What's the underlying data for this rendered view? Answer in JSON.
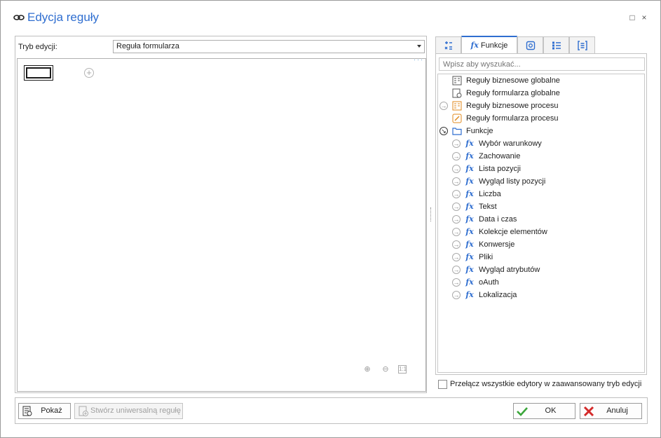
{
  "window": {
    "title": "Edycja reguły",
    "maximize_glyph": "□",
    "close_glyph": "×"
  },
  "editor": {
    "mode_label": "Tryb edycji:",
    "mode_value": "Reguła formularza",
    "add_glyph": "+",
    "zoom_in_glyph": "⊕",
    "zoom_out_glyph": "⊖",
    "zoom_reset_glyph": "1:1"
  },
  "tabs": {
    "operators_icon": "operators-icon",
    "functions_label": "Funkcje",
    "values_icon": "values-icon",
    "list_icon": "list-icon",
    "form_icon": "form-icon"
  },
  "search": {
    "placeholder": "Wpisz aby wyszukać..."
  },
  "tree": {
    "global_business": "Reguły biznesowe globalne",
    "global_form": "Reguły formularza globalne",
    "process_business": "Reguły biznesowe procesu",
    "process_form": "Reguły formularza procesu",
    "functions": "Funkcje",
    "function_items": [
      "Wybór warunkowy",
      "Zachowanie",
      "Lista pozycji",
      "Wygląd listy pozycji",
      "Liczba",
      "Tekst",
      "Data i czas",
      "Kolekcje elementów",
      "Konwersje",
      "Pliki",
      "Wygląd atrybutów",
      "oAuth",
      "Lokalizacja"
    ]
  },
  "toggle": {
    "label": "Przełącz wszystkie edytory w zaawansowany tryb edycji",
    "checked": false
  },
  "buttons": {
    "show": "Pokaż",
    "create_universal": "Stwórz uniwersalną regułę",
    "ok": "OK",
    "cancel": "Anuluj"
  },
  "colors": {
    "accent": "#2f6ed0",
    "ok_green": "#3aa63a",
    "cancel_red": "#d42a2a"
  }
}
